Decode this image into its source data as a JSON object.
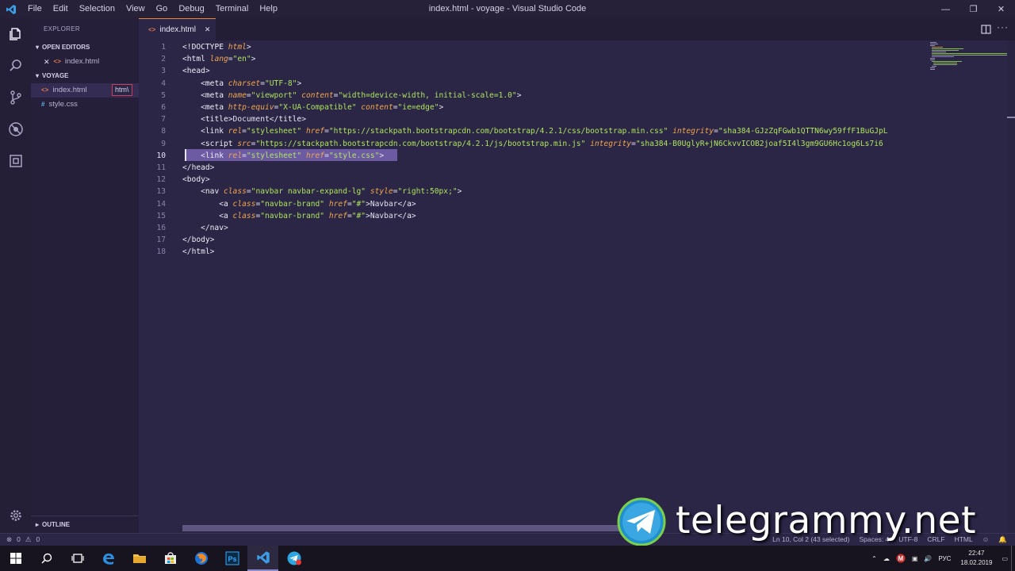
{
  "window": {
    "title": "index.html - voyage - Visual Studio Code",
    "menu": [
      "File",
      "Edit",
      "Selection",
      "View",
      "Go",
      "Debug",
      "Terminal",
      "Help"
    ]
  },
  "sidebar": {
    "header": "EXPLORER",
    "open_editors_label": "OPEN EDITORS",
    "open_editors": [
      {
        "name": "index.html"
      }
    ],
    "project_label": "VOYAGE",
    "files": [
      {
        "name": "index.html",
        "type": "html"
      },
      {
        "name": "style.css",
        "type": "css"
      }
    ],
    "tooltip": "htm\\",
    "outline_label": "OUTLINE"
  },
  "tab": {
    "label": "index.html"
  },
  "editor": {
    "active_line": 10,
    "lines": [
      {
        "n": "1",
        "parts": [
          [
            "p",
            "<!"
          ],
          [
            "t",
            "DOCTYPE "
          ],
          [
            "a",
            "html"
          ],
          [
            "p",
            ">"
          ]
        ]
      },
      {
        "n": "2",
        "parts": [
          [
            "p",
            "<"
          ],
          [
            "t",
            "html "
          ],
          [
            "a",
            "lang"
          ],
          [
            "p",
            "="
          ],
          [
            "s",
            "\"en\""
          ],
          [
            "p",
            ">"
          ]
        ]
      },
      {
        "n": "3",
        "parts": [
          [
            "p",
            "<"
          ],
          [
            "t",
            "head"
          ],
          [
            "p",
            ">"
          ]
        ]
      },
      {
        "n": "4",
        "parts": [
          [
            "p",
            "    <"
          ],
          [
            "t",
            "meta "
          ],
          [
            "a",
            "charset"
          ],
          [
            "p",
            "="
          ],
          [
            "s",
            "\"UTF-8\""
          ],
          [
            "p",
            ">"
          ]
        ]
      },
      {
        "n": "5",
        "parts": [
          [
            "p",
            "    <"
          ],
          [
            "t",
            "meta "
          ],
          [
            "a",
            "name"
          ],
          [
            "p",
            "="
          ],
          [
            "s",
            "\"viewport\" "
          ],
          [
            "a",
            "content"
          ],
          [
            "p",
            "="
          ],
          [
            "s",
            "\"width=device-width, initial-scale=1.0\""
          ],
          [
            "p",
            ">"
          ]
        ]
      },
      {
        "n": "6",
        "parts": [
          [
            "p",
            "    <"
          ],
          [
            "t",
            "meta "
          ],
          [
            "a",
            "http-equiv"
          ],
          [
            "p",
            "="
          ],
          [
            "s",
            "\"X-UA-Compatible\" "
          ],
          [
            "a",
            "content"
          ],
          [
            "p",
            "="
          ],
          [
            "s",
            "\"ie=edge\""
          ],
          [
            "p",
            ">"
          ]
        ]
      },
      {
        "n": "7",
        "parts": [
          [
            "p",
            "    <"
          ],
          [
            "t",
            "title"
          ],
          [
            "p",
            ">Document</"
          ],
          [
            "t",
            "title"
          ],
          [
            "p",
            ">"
          ]
        ]
      },
      {
        "n": "8",
        "parts": [
          [
            "p",
            "    <"
          ],
          [
            "t",
            "link "
          ],
          [
            "a",
            "rel"
          ],
          [
            "p",
            "="
          ],
          [
            "s",
            "\"stylesheet\" "
          ],
          [
            "a",
            "href"
          ],
          [
            "p",
            "="
          ],
          [
            "s",
            "\"https://stackpath.bootstrapcdn.com/bootstrap/4.2.1/css/bootstrap.min.css\" "
          ],
          [
            "a",
            "integrity"
          ],
          [
            "p",
            "="
          ],
          [
            "s",
            "\"sha384-GJzZqFGwb1QTTN6wy59ffF1BuGJpL"
          ]
        ]
      },
      {
        "n": "9",
        "parts": [
          [
            "p",
            "    <"
          ],
          [
            "t",
            "script "
          ],
          [
            "a",
            "src"
          ],
          [
            "p",
            "="
          ],
          [
            "s",
            "\"https://stackpath.bootstrapcdn.com/bootstrap/4.2.1/js/bootstrap.min.js\" "
          ],
          [
            "a",
            "integrity"
          ],
          [
            "p",
            "="
          ],
          [
            "s",
            "\"sha384-B0UglyR+jN6CkvvICOB2joaf5I4l3gm9GU6Hc1og6Ls7i6"
          ]
        ]
      },
      {
        "n": "10",
        "parts": [
          [
            "p",
            "    <"
          ],
          [
            "t",
            "link "
          ],
          [
            "a",
            "rel"
          ],
          [
            "p",
            "="
          ],
          [
            "s",
            "\"stylesheet\" "
          ],
          [
            "a",
            "href"
          ],
          [
            "p",
            "="
          ],
          [
            "s",
            "\"style.css\""
          ],
          [
            "p",
            ">"
          ]
        ]
      },
      {
        "n": "11",
        "parts": [
          [
            "p",
            "</"
          ],
          [
            "t",
            "head"
          ],
          [
            "p",
            ">"
          ]
        ]
      },
      {
        "n": "12",
        "parts": [
          [
            "p",
            "<"
          ],
          [
            "t",
            "body"
          ],
          [
            "p",
            ">"
          ]
        ]
      },
      {
        "n": "13",
        "parts": [
          [
            "p",
            "    <"
          ],
          [
            "t",
            "nav "
          ],
          [
            "a",
            "class"
          ],
          [
            "p",
            "="
          ],
          [
            "s",
            "\"navbar navbar-expand-lg\" "
          ],
          [
            "a",
            "style"
          ],
          [
            "p",
            "="
          ],
          [
            "s",
            "\"right:50px;\""
          ],
          [
            "p",
            ">"
          ]
        ]
      },
      {
        "n": "14",
        "parts": [
          [
            "p",
            "        <"
          ],
          [
            "t",
            "a "
          ],
          [
            "a",
            "class"
          ],
          [
            "p",
            "="
          ],
          [
            "s",
            "\"navbar-brand\" "
          ],
          [
            "a",
            "href"
          ],
          [
            "p",
            "="
          ],
          [
            "s",
            "\"#\""
          ],
          [
            "p",
            ">Navbar</"
          ],
          [
            "t",
            "a"
          ],
          [
            "p",
            ">"
          ]
        ]
      },
      {
        "n": "15",
        "parts": [
          [
            "p",
            "        <"
          ],
          [
            "t",
            "a "
          ],
          [
            "a",
            "class"
          ],
          [
            "p",
            "="
          ],
          [
            "s",
            "\"navbar-brand\" "
          ],
          [
            "a",
            "href"
          ],
          [
            "p",
            "="
          ],
          [
            "s",
            "\"#\""
          ],
          [
            "p",
            ">Navbar</"
          ],
          [
            "t",
            "a"
          ],
          [
            "p",
            ">"
          ]
        ]
      },
      {
        "n": "16",
        "parts": [
          [
            "p",
            "    </"
          ],
          [
            "t",
            "nav"
          ],
          [
            "p",
            ">"
          ]
        ]
      },
      {
        "n": "17",
        "parts": [
          [
            "p",
            "</"
          ],
          [
            "t",
            "body"
          ],
          [
            "p",
            ">"
          ]
        ]
      },
      {
        "n": "18",
        "parts": [
          [
            "p",
            "</"
          ],
          [
            "t",
            "html"
          ],
          [
            "p",
            ">"
          ]
        ]
      }
    ]
  },
  "statusbar": {
    "errors": "0",
    "warnings": "0",
    "position": "Ln 10, Col 2 (43 selected)",
    "spaces": "Spaces: 4",
    "encoding": "UTF-8",
    "eol": "CRLF",
    "language": "HTML"
  },
  "watermark": "telegrammy.net",
  "taskbar": {
    "language": "РУС",
    "time": "22:47",
    "date": "18.02.2019"
  }
}
